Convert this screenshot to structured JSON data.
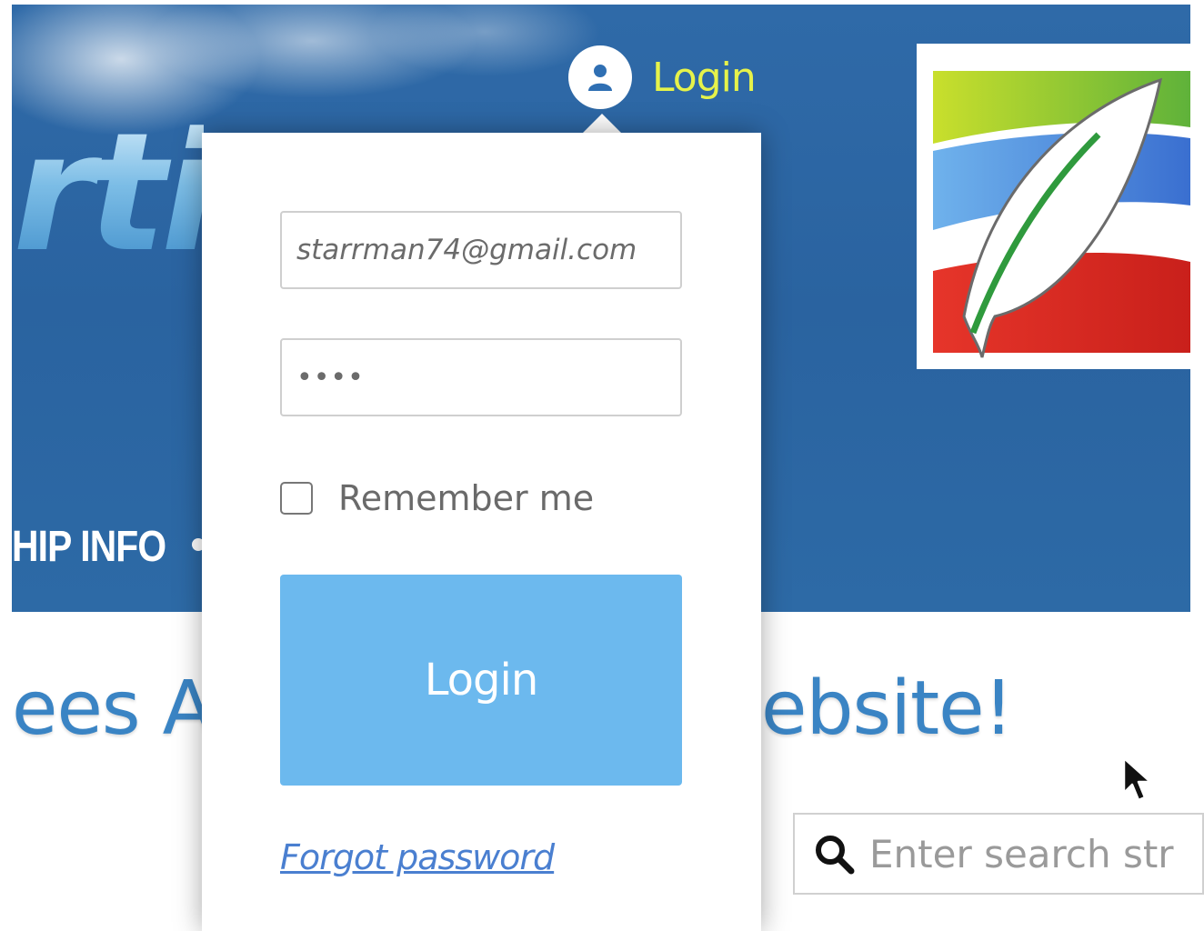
{
  "header": {
    "site_title_fragment": "rtic",
    "nav_fragment": "HIP INFO",
    "login_trigger": {
      "label": "Login",
      "icon": "user-icon"
    },
    "logo": {
      "icon": "feather-logo",
      "colors": [
        "#8cc63f",
        "#3b82d6",
        "#d6281f"
      ]
    }
  },
  "login_panel": {
    "email_value": "starrman74@gmail.com",
    "password_mask": "••••",
    "remember_label": "Remember me",
    "remember_checked": false,
    "submit_label": "Login",
    "forgot_label": "Forgot password"
  },
  "main": {
    "welcome_left": "ees A",
    "welcome_right": "ebsite!",
    "search": {
      "placeholder": "Enter search str",
      "icon": "search-icon"
    }
  },
  "colors": {
    "header_blue": "#2d68a5",
    "login_trigger_yellow": "#e6f24a",
    "button_blue": "#6cb9ee",
    "link_blue": "#4a7fd0",
    "heading_blue": "#3a84c4"
  }
}
